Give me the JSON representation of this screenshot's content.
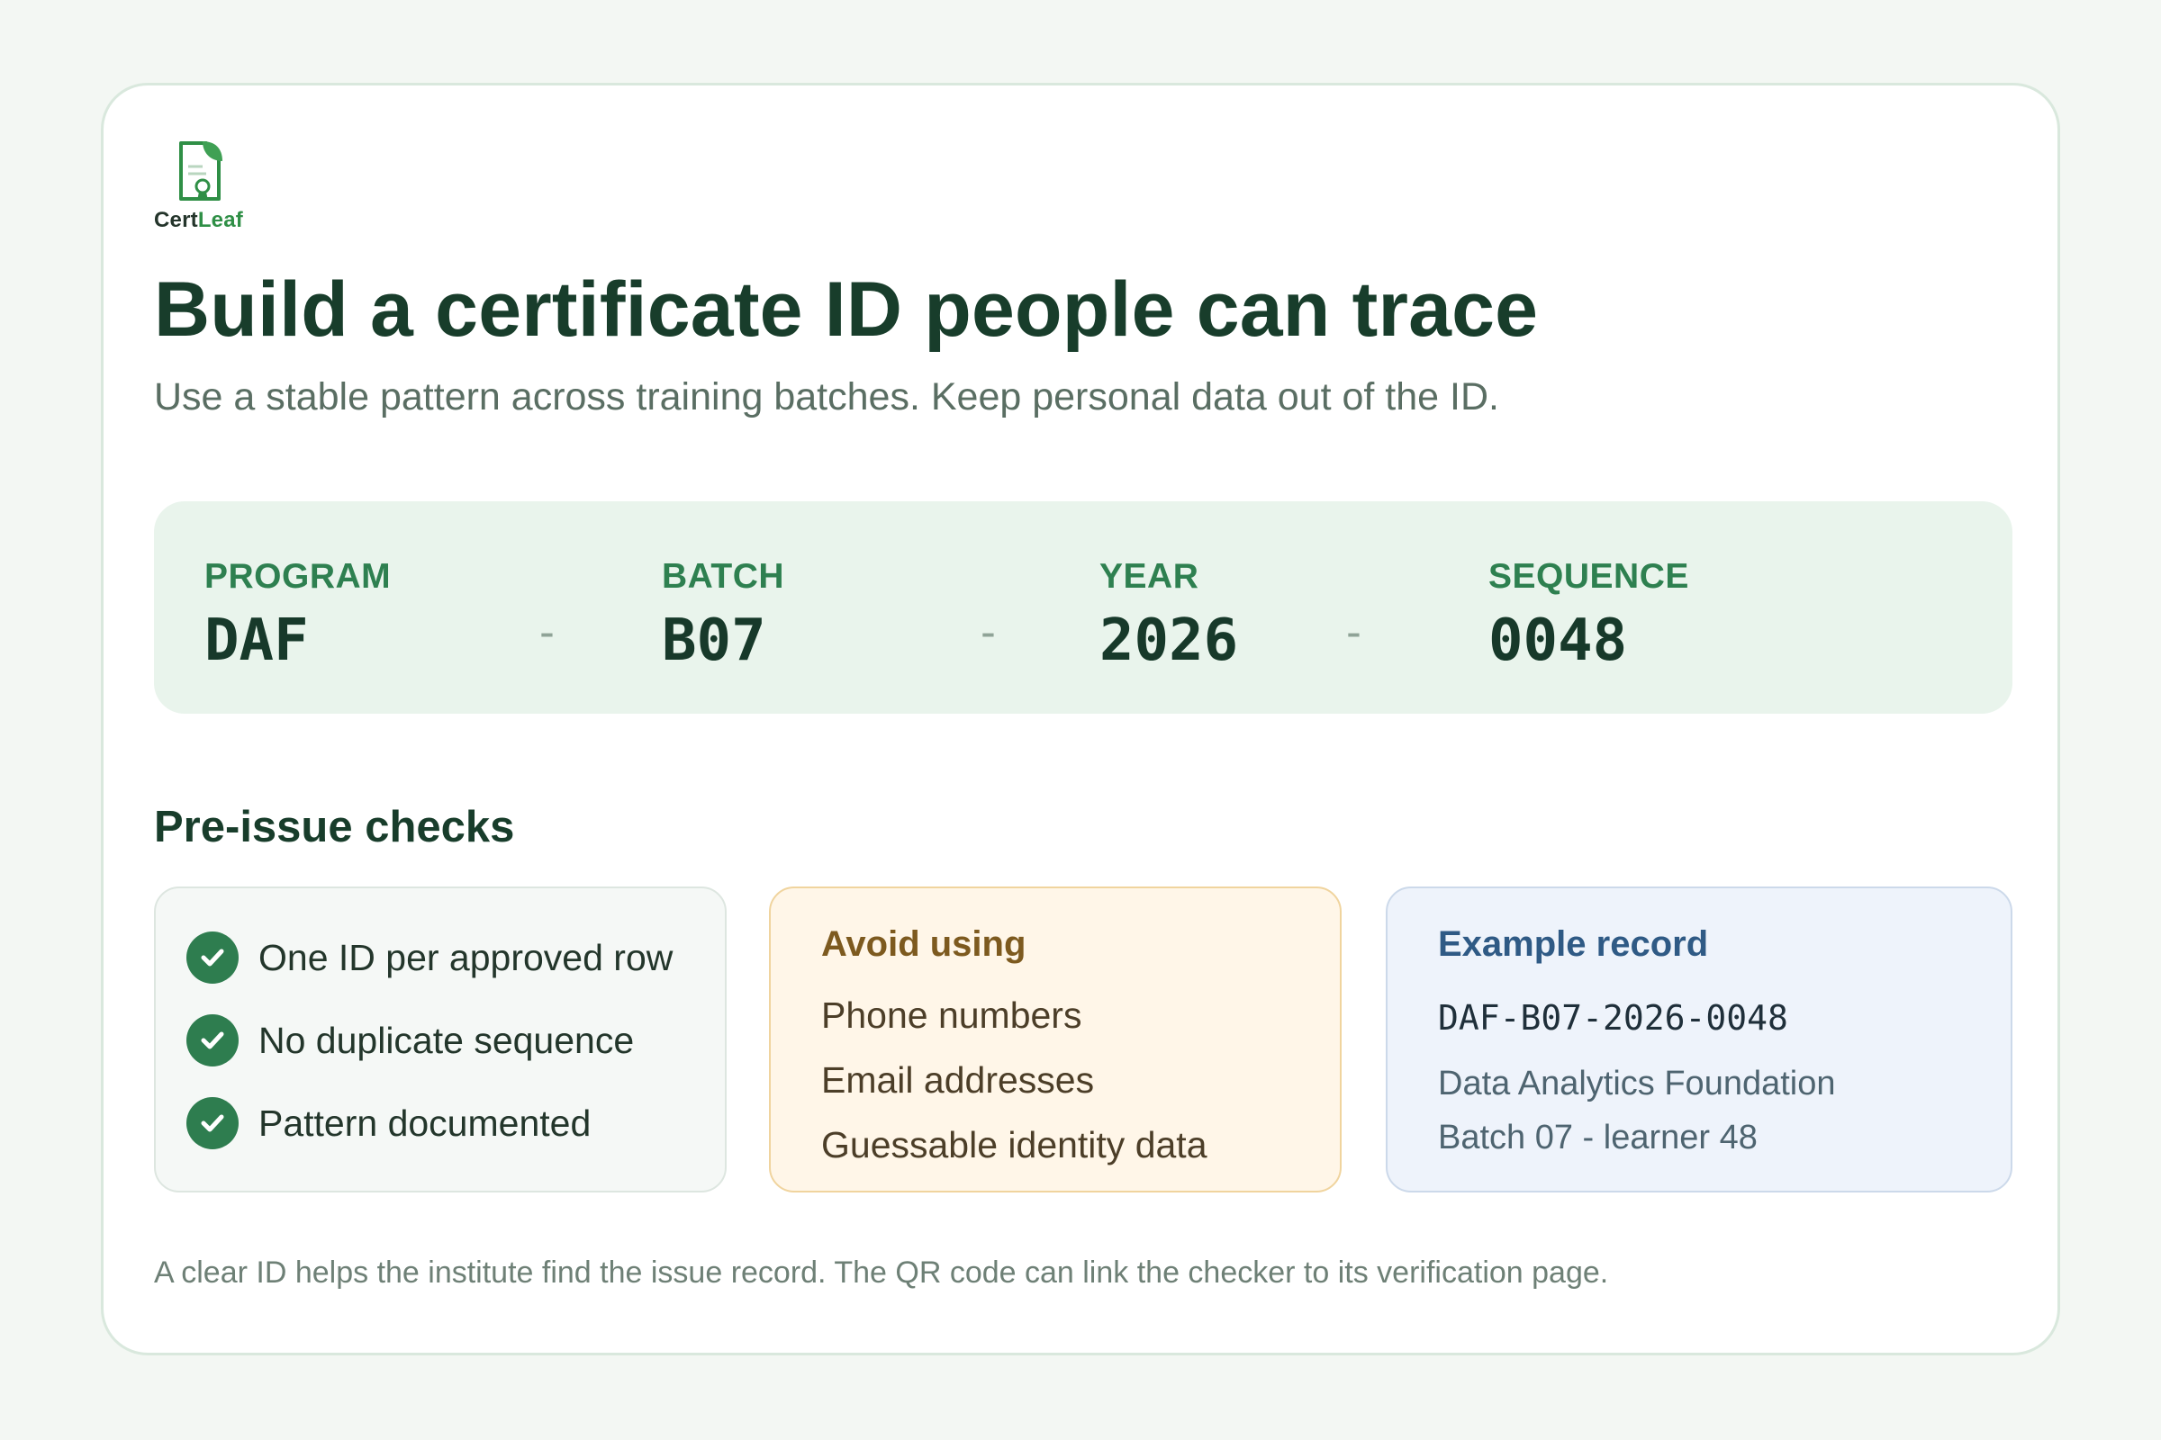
{
  "brand": {
    "name_part1": "Cert",
    "name_part2": "Leaf"
  },
  "header": {
    "title": "Build a certificate ID people can trace",
    "subtitle": "Use a stable pattern across training batches. Keep personal data out of the ID."
  },
  "pattern": {
    "separator": "-",
    "segments": [
      {
        "label": "PROGRAM",
        "value": "DAF"
      },
      {
        "label": "BATCH",
        "value": "B07"
      },
      {
        "label": "YEAR",
        "value": "2026"
      },
      {
        "label": "SEQUENCE",
        "value": "0048"
      }
    ]
  },
  "checks": {
    "heading": "Pre-issue checks",
    "items": [
      "One ID per approved row",
      "No duplicate sequence",
      "Pattern documented"
    ]
  },
  "avoid": {
    "title": "Avoid using",
    "items": [
      "Phone numbers",
      "Email addresses",
      "Guessable identity data"
    ]
  },
  "example": {
    "title": "Example record",
    "id": "DAF-B07-2026-0048",
    "line1": "Data Analytics Foundation",
    "line2": "Batch 07 - learner 48"
  },
  "footnote": "A clear ID helps the institute find the issue record. The QR code can link the checker to its verification page.",
  "colors": {
    "accent": "#2e7d4f",
    "heading": "#183d2b",
    "pattern_bg": "#e9f4ec",
    "avoid_bg": "#fff6e8",
    "example_bg": "#eef3fb"
  }
}
